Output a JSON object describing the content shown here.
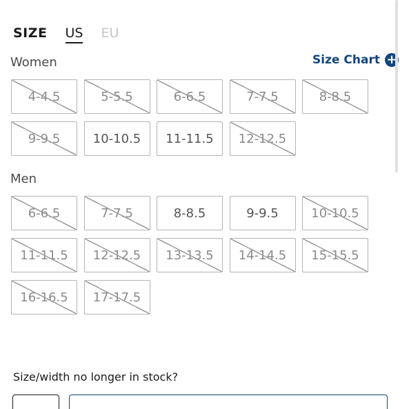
{
  "tabs": {
    "size": "SIZE",
    "us": "US",
    "eu": "EU"
  },
  "women": {
    "title": "Women",
    "size_chart_label": "Size Chart",
    "sizes": [
      {
        "label": "4-4.5",
        "available": false
      },
      {
        "label": "5-5.5",
        "available": false
      },
      {
        "label": "6-6.5",
        "available": false
      },
      {
        "label": "7-7.5",
        "available": false
      },
      {
        "label": "8-8.5",
        "available": false
      },
      {
        "label": "9-9.5",
        "available": false
      },
      {
        "label": "10-10.5",
        "available": true
      },
      {
        "label": "11-11.5",
        "available": true
      },
      {
        "label": "12-12.5",
        "available": false
      }
    ]
  },
  "men": {
    "title": "Men",
    "sizes": [
      {
        "label": "6-6.5",
        "available": false
      },
      {
        "label": "7-7.5",
        "available": false
      },
      {
        "label": "8-8.5",
        "available": true
      },
      {
        "label": "9-9.5",
        "available": true
      },
      {
        "label": "10-10.5",
        "available": false
      },
      {
        "label": "11-11.5",
        "available": false
      },
      {
        "label": "12-12.5",
        "available": false
      },
      {
        "label": "13-13.5",
        "available": false
      },
      {
        "label": "14-14.5",
        "available": false
      },
      {
        "label": "15-15.5",
        "available": false
      },
      {
        "label": "16-16.5",
        "available": false
      },
      {
        "label": "17-17.5",
        "available": false
      }
    ]
  },
  "out_of_stock_prompt": "Size/width no longer in stock?",
  "colors": {
    "accent": "#14467a",
    "text": "#1b1b1b",
    "border": "#b3b3b3"
  }
}
